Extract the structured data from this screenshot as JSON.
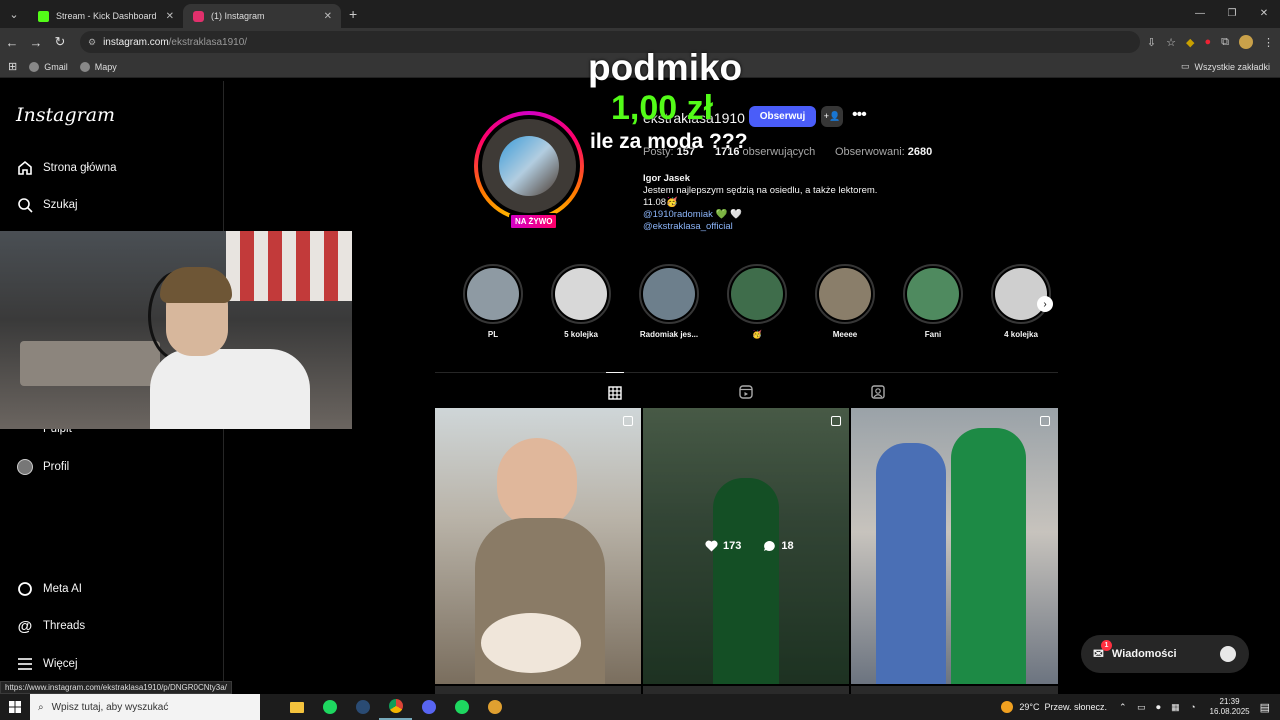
{
  "browser": {
    "tabs": [
      {
        "title": "Stream - Kick Dashboard",
        "active": false,
        "favicon_color": "#53fc18"
      },
      {
        "title": "(1) Instagram",
        "active": true,
        "favicon_color": "#e1306c"
      }
    ],
    "url_host": "instagram.com",
    "url_path": "/ekstraklasa1910/",
    "bookmarks": [
      "Gmail",
      "Mapy"
    ],
    "all_bookmarks": "Wszystkie zakładki",
    "status_url": "https://www.instagram.com/ekstraklasa1910/p/DNGR0CNty3a/"
  },
  "instagram": {
    "logo": "Instagram",
    "nav": [
      {
        "label": "Strona główna",
        "icon": "home-icon"
      },
      {
        "label": "Szukaj",
        "icon": "search-icon"
      },
      {
        "label": "Pulpit",
        "icon": "dashboard-icon"
      },
      {
        "label": "Profil",
        "icon": "profile-icon"
      },
      {
        "label": "Meta AI",
        "icon": "meta-ai-icon"
      },
      {
        "label": "Threads",
        "icon": "threads-icon"
      },
      {
        "label": "Więcej",
        "icon": "menu-icon"
      }
    ],
    "profile": {
      "username": "ekstraklasa1910",
      "live_badge": "NA ŻYWO",
      "follow_button": "Obserwuj",
      "posts_label": "Posty:",
      "posts_value": "157",
      "followers_value": "1716",
      "followers_label": "obserwujących",
      "following_label": "Obserwowani:",
      "following_value": "2680",
      "name": "Igor Jasek",
      "bio_line1": "Jestem najlepszym sędzią na osiedlu, a także lektorem.",
      "bio_line2": "11.08🥳",
      "bio_link1": "@1910radomiak",
      "bio_link1_suffix": " 💚 🤍",
      "bio_link2": "@ekstraklasa_official"
    },
    "highlights": [
      {
        "label": "PL",
        "color": "#8e9aa3"
      },
      {
        "label": "5 kolejka",
        "color": "#d8d8d8"
      },
      {
        "label": "Radomiak jes...",
        "color": "#6d7f8c"
      },
      {
        "label": "🥳",
        "color": "#3f6d4b"
      },
      {
        "label": "Meeee",
        "color": "#8a7e6a"
      },
      {
        "label": "Fani",
        "color": "#4f8a5f"
      },
      {
        "label": "4 kolejka",
        "color": "#cfcfcf"
      }
    ],
    "post_tabs": [
      "grid-icon",
      "reels-icon",
      "tagged-icon"
    ],
    "hovered_post": {
      "likes": "173",
      "comments": "18"
    },
    "messages_label": "Wiadomości",
    "messages_badge": "1"
  },
  "overlay": {
    "donor": "podmiko",
    "amount": "1,00 zł",
    "message": "ile za moda ???"
  },
  "taskbar": {
    "search_placeholder": "Wpisz tutaj, aby wyszukać",
    "weather": "29°C  Przew. słonecz.",
    "time": "21:39",
    "date": "16.08.2025"
  }
}
